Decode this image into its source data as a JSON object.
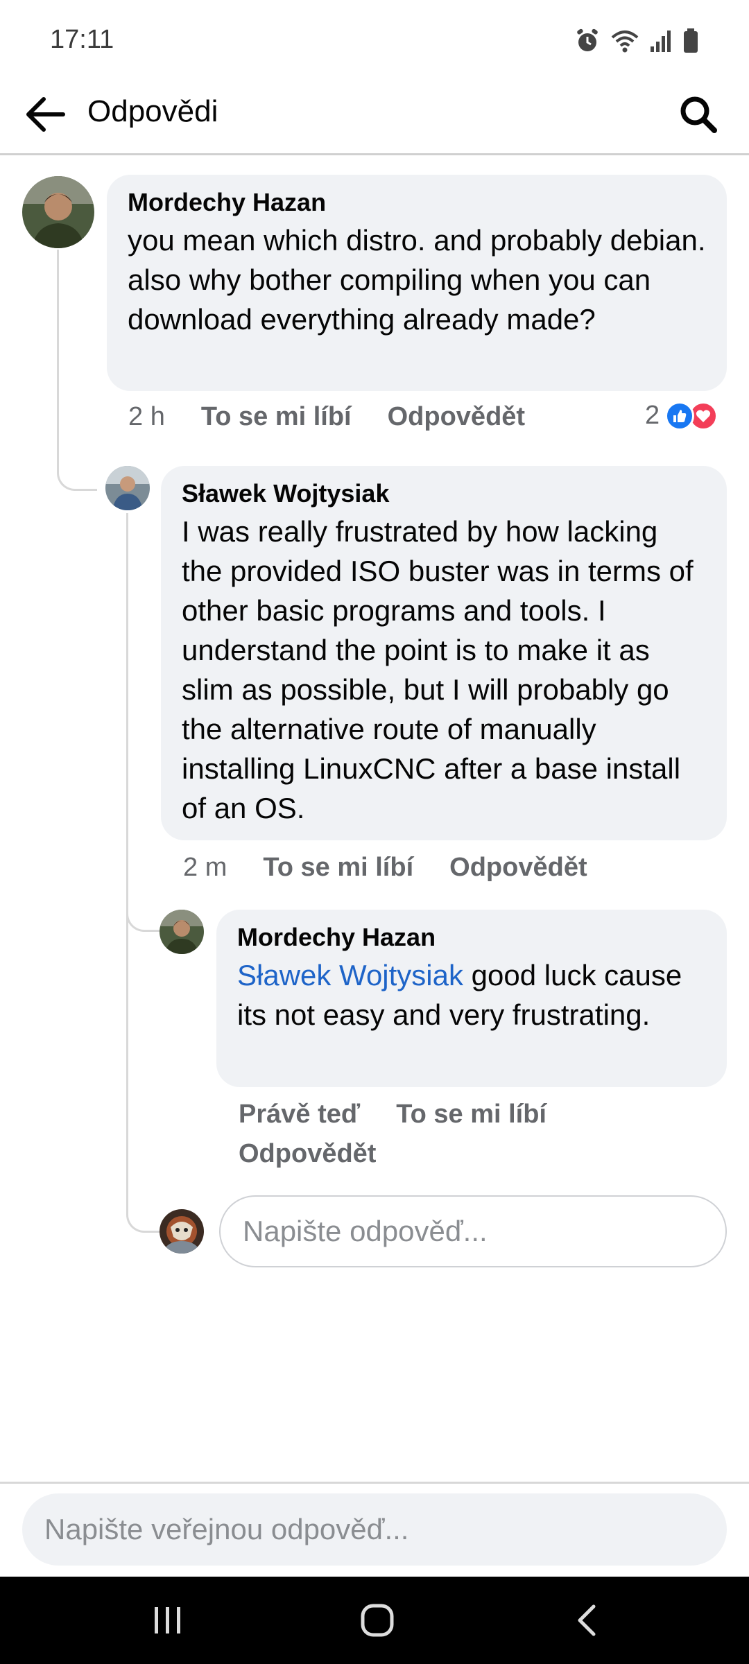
{
  "status_bar": {
    "time": "17:11"
  },
  "header": {
    "title": "Odpovědi"
  },
  "comments": [
    {
      "author": "Mordechy Hazan",
      "text": "you mean which distro. and probably debian. also why bother compiling when you can download everything already made?",
      "time": "2 h",
      "like_label": "To se mi líbí",
      "reply_label": "Odpovědět",
      "reaction_count": "2"
    },
    {
      "author": "Sławek Wojtysiak",
      "text": "I was really frustrated by how lacking the provided ISO buster was in terms of other basic programs and tools. I understand the point is to make it as slim as possible, but I will probably go the alternative route of manually installing LinuxCNC after a base install of an OS.",
      "time": "2 m",
      "like_label": "To se mi líbí",
      "reply_label": "Odpovědět"
    },
    {
      "author": "Mordechy Hazan",
      "mention": "Sławek Wojtysiak",
      "text": " good luck cause its not easy and very frustrating.",
      "time": "Právě teď",
      "like_label": "To se mi líbí",
      "reply_label": "Odpovědět"
    }
  ],
  "reply_input": {
    "placeholder": "Napište odpověď..."
  },
  "composer": {
    "placeholder": "Napište veřejnou odpověď..."
  },
  "colors": {
    "accent": "#1e64c8",
    "like_blue": "#1877f2",
    "love_red": "#f33e58",
    "bubble_bg": "#f0f2f5"
  },
  "icons": [
    "back-arrow-icon",
    "search-icon",
    "alarm-icon",
    "wifi-icon",
    "signal-icon",
    "battery-icon",
    "like-reaction-icon",
    "love-reaction-icon",
    "recents-icon",
    "home-icon",
    "back-nav-icon"
  ]
}
